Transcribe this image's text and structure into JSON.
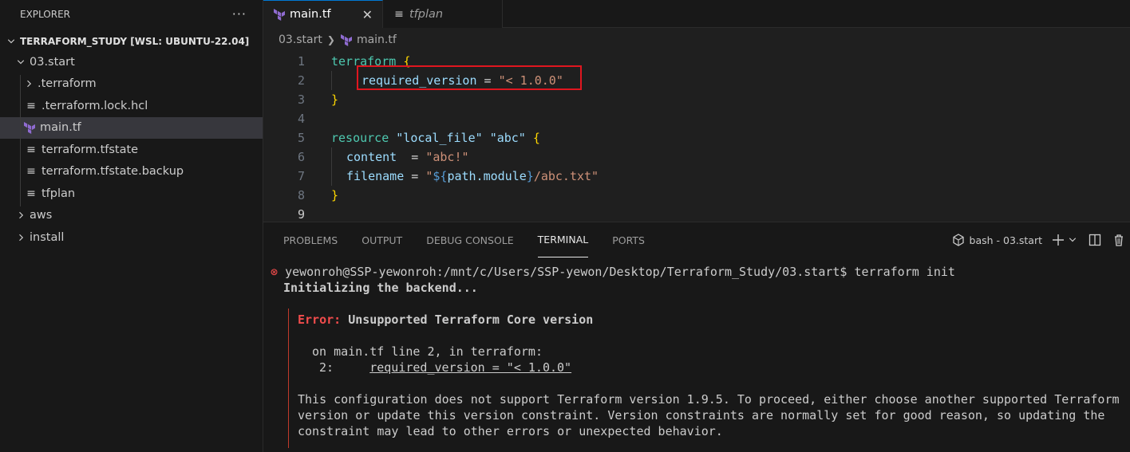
{
  "sidebar": {
    "title": "EXPLORER",
    "more": "···",
    "workspace": "TERRAFORM_STUDY [WSL: UBUNTU-22.04]",
    "tree": [
      {
        "label": "03.start",
        "kind": "folder-open"
      },
      {
        "label": ".terraform",
        "kind": "folder"
      },
      {
        "label": ".terraform.lock.hcl",
        "kind": "file"
      },
      {
        "label": "main.tf",
        "kind": "terraform",
        "selected": true
      },
      {
        "label": "terraform.tfstate",
        "kind": "file"
      },
      {
        "label": "terraform.tfstate.backup",
        "kind": "file"
      },
      {
        "label": "tfplan",
        "kind": "file"
      },
      {
        "label": "aws",
        "kind": "folder"
      },
      {
        "label": "install",
        "kind": "folder"
      }
    ]
  },
  "editor": {
    "tabs": [
      {
        "label": "main.tf",
        "close": "✕"
      },
      {
        "label": "tfplan"
      }
    ],
    "breadcrumb": {
      "folder": "03.start",
      "file": "main.tf"
    },
    "line_numbers": [
      "1",
      "2",
      "3",
      "4",
      "5",
      "6",
      "7",
      "8",
      "9"
    ],
    "code": {
      "l1_kw": "terraform",
      "l1_br": "{",
      "l2_attr": "required_version",
      "l2_eq": " = ",
      "l2_val": "\"< 1.0.0\"",
      "l3_br": "}",
      "l5_kw": "resource",
      "l5_s1": "\"local_file\"",
      "l5_s2": "\"abc\"",
      "l5_br": "{",
      "l6_attr": "content",
      "l6_eq": "  = ",
      "l6_val": "\"abc!\"",
      "l7_attr": "filename",
      "l7_eq": " = ",
      "l7_q1": "\"",
      "l7_i1": "${",
      "l7_path": "path.module",
      "l7_i2": "}",
      "l7_rest": "/abc.txt\"",
      "l8_br": "}"
    }
  },
  "panel": {
    "tabs": [
      "PROBLEMS",
      "OUTPUT",
      "DEBUG CONSOLE",
      "TERMINAL",
      "PORTS"
    ],
    "active_tab": "TERMINAL",
    "shell": "bash - 03.start",
    "terminal": {
      "prompt": "yewonroh@SSP-yewonroh:/mnt/c/Users/SSP-yewon/Desktop/Terraform_Study/03.start$ terraform init",
      "init": "Initializing the backend...",
      "error_label": "Error:",
      "error_title": "Unsupported Terraform Core version",
      "location": "on main.tf line 2, in terraform:",
      "line_no": "2:",
      "line_code": "required_version = \"< 1.0.0\"",
      "msg1": "This configuration does not support Terraform version 1.9.5. To proceed, either choose another supported Terraform",
      "msg2": "version or update this version constraint. Version constraints are normally set for good reason, so updating the",
      "msg3": "constraint may lead to other errors or unexpected behavior."
    }
  },
  "colors": {
    "accent": "#0078d4",
    "error": "#f14c4c",
    "highlight_box": "#e0161f"
  }
}
